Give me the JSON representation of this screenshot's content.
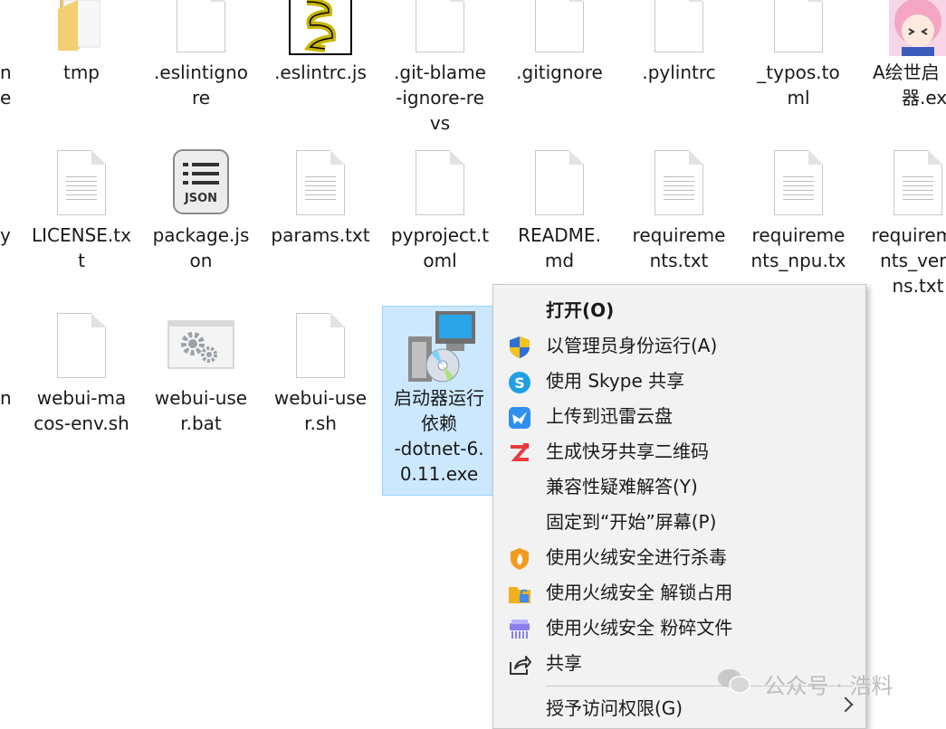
{
  "files": [
    {
      "name": "tmp"
    },
    {
      "name": ".eslintignore"
    },
    {
      "name": ".eslintrc.js"
    },
    {
      "name": ".git-blame-ignore-revs"
    },
    {
      "name": ".gitignore"
    },
    {
      "name": ".pylintrc"
    },
    {
      "name": "_typos.toml"
    },
    {
      "name": "A绘世启动器.exe"
    },
    {
      "name": "LICENSE.txt"
    },
    {
      "name": "package.json"
    },
    {
      "name": "params.txt"
    },
    {
      "name": "pyproject.toml"
    },
    {
      "name": "README.md"
    },
    {
      "name": "requirements.txt"
    },
    {
      "name": "requirements_npu.txt"
    },
    {
      "name": "requirements_versions.txt"
    },
    {
      "name": "webui-macos-env.sh"
    },
    {
      "name": "webui-user.bat"
    },
    {
      "name": "webui-user.sh"
    },
    {
      "name": "启动器运行依赖-dotnet-6.0.11.exe"
    }
  ],
  "display": {
    "tmp": "tmp",
    "eslintignore": ".eslintignore",
    "eslintignore_1": ".eslintigno",
    "eslintignore_2": "re",
    "eslintrc": ".eslintrc.js",
    "gitblame_1": ".git-blame",
    "gitblame_2": "-ignore-re",
    "gitblame_3": "vs",
    "gitignore": ".gitignore",
    "pylintrc": ".pylintrc",
    "typos_1": "_typos.to",
    "typos_2": "ml",
    "launcher_1": "A绘世启",
    "launcher_2": "器.exe",
    "license_1": "LICENSE.tx",
    "license_2": "t",
    "package_1": "package.js",
    "package_2": "on",
    "params": "params.txt",
    "pyproject_1": "pyproject.t",
    "pyproject_2": "oml",
    "readme_1": "README.",
    "readme_2": "md",
    "req_1": "requireme",
    "req_2": "nts.txt",
    "reqnpu_1": "requireme",
    "reqnpu_2": "nts_npu.tx",
    "reqver_1": "requireme",
    "reqver_2": "nts_vers",
    "reqver_3": "ns.txt",
    "macos_1": "webui-ma",
    "macos_2": "cos-env.sh",
    "userbat_1": "webui-use",
    "userbat_2": "r.bat",
    "usersh_1": "webui-use",
    "usersh_2": "r.sh",
    "dotnet_1": "启动器运行",
    "dotnet_2": "依赖",
    "dotnet_3": "-dotnet-6.",
    "dotnet_4": "0.11.exe",
    "left_1": "n",
    "left_2": "e",
    "left_3": "y",
    "left_4": "n",
    "json_label": "JSON"
  },
  "context_menu": {
    "items": [
      {
        "label": "打开(O)",
        "icon": "none",
        "bold": true
      },
      {
        "label": "以管理员身份运行(A)",
        "icon": "uac-shield-icon"
      },
      {
        "label": "使用 Skype 共享",
        "icon": "skype-icon"
      },
      {
        "label": "上传到迅雷云盘",
        "icon": "xunlei-icon"
      },
      {
        "label": "生成快牙共享二维码",
        "icon": "kuaiya-icon"
      },
      {
        "label": "兼容性疑难解答(Y)",
        "icon": "none"
      },
      {
        "label": "固定到“开始”屏幕(P)",
        "icon": "none"
      },
      {
        "label": "使用火绒安全进行杀毒",
        "icon": "huorong-icon"
      },
      {
        "label": "使用火绒安全 解锁占用",
        "icon": "huorong-unlock-icon"
      },
      {
        "label": "使用火绒安全 粉碎文件",
        "icon": "huorong-shred-icon"
      },
      {
        "label": "共享",
        "icon": "share-icon"
      },
      {
        "label": "授予访问权限(G)",
        "icon": "none",
        "submenu": true
      }
    ]
  },
  "watermark": {
    "text": "公众号 · 浩料"
  },
  "colors": {
    "selection": "#cce8ff",
    "selection_border": "#99d1ff",
    "menu_bg": "#f2f2f2"
  }
}
